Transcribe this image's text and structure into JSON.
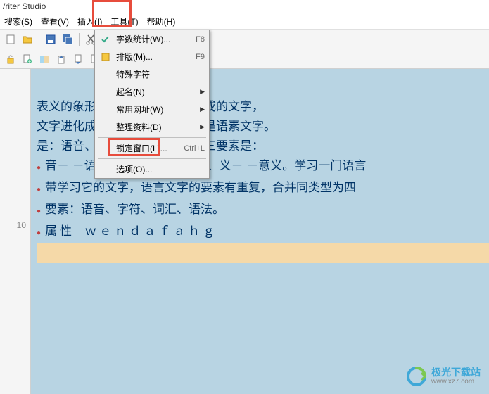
{
  "title": "/riter Studio",
  "menus": {
    "search": "搜索(S)",
    "view": "查看(V)",
    "insert": "插入(I)",
    "tools": "工具(T)",
    "help": "帮助(H)"
  },
  "dropdown": {
    "wordcount": {
      "label": "字数统计(W)...",
      "shortcut": "F8"
    },
    "typeset": {
      "label": "排版(M)...",
      "shortcut": "F9"
    },
    "specialchar": {
      "label": "特殊字符"
    },
    "naming": {
      "label": "起名(N)"
    },
    "urls": {
      "label": "常用网址(W)"
    },
    "materials": {
      "label": "整理资料(D)"
    },
    "lockwin": {
      "label": "锁定窗口(L)...",
      "shortcut": "Ctrl+L"
    },
    "options": {
      "label": "选项(O)..."
    }
  },
  "gutter": {
    "line10": "10"
  },
  "doc": {
    "l1": "表义的象形符号和表音的声旁组成的文字，",
    "l2": "文字进化成的意音文字，汉字也是语素文字。",
    "l3": "是：语音、词汇和语法，文字的三要素是：",
    "l4": "音－ －语音、形－ －字符形状、义－ －意义。学习一门语言",
    "l5": "带学习它的文字，语言文字的要素有重复，合并同类型为四",
    "l6": "要素：语音、字符、词汇、语法。",
    "l7": "属性  ｗｅｎｄａｆａｈｇ"
  },
  "watermark": {
    "brand": "极光下载站",
    "url": "www.xz7.com"
  }
}
